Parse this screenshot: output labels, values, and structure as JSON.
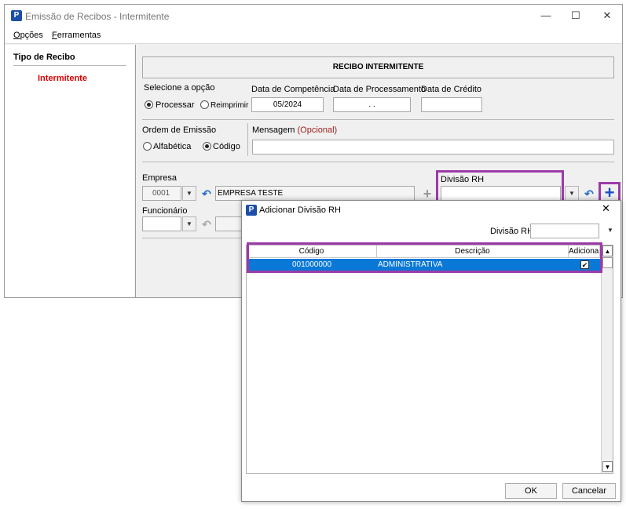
{
  "window": {
    "title": "Emissão de Recibos - Intermitente",
    "app_icon": "P",
    "controls": {
      "minimize": "—",
      "maximize": "☐",
      "close": "✕"
    }
  },
  "menu": {
    "opcoes_prefix": "O",
    "opcoes_rest": "pções",
    "ferramentas_prefix": "F",
    "ferramentas_rest": "erramentas"
  },
  "sidebar": {
    "heading": "Tipo de Recibo",
    "selected": "Intermitente",
    "selected_color": "#e00000"
  },
  "form": {
    "header": "RECIBO INTERMITENTE",
    "selecione_label": "Selecione a opção",
    "opt_processar": "Processar",
    "opt_reimprimir": "Reimprimir",
    "selected_option": "Processar",
    "competencia_label": "Data de Competência",
    "competencia_value": "05/2024",
    "processamento_label": "Data de Processamento",
    "processamento_value": "  .  .",
    "credito_label": "Data de Crédito",
    "credito_value": "",
    "ordem_label": "Ordem de Emissão",
    "ordem_alfabetica": "Alfabética",
    "ordem_codigo": "Código",
    "ordem_selected": "Código",
    "mensagem_label": "Mensagem",
    "mensagem_opcional": "(Opcional)",
    "mensagem_value": "",
    "empresa_label": "Empresa",
    "empresa_code": "0001",
    "empresa_name": "EMPRESA TESTE",
    "divisao_label": "Divisão RH",
    "divisao_value": "",
    "funcionario_label": "Funcionário",
    "funcionario_value": ""
  },
  "dialog": {
    "title": "Adicionar Divisão RH",
    "close": "✕",
    "filter_label": "Divisão RH:",
    "filter_value": "",
    "columns": [
      "Código",
      "Descrição",
      "Adicionar"
    ],
    "rows": [
      {
        "codigo": "001000000",
        "descricao": "ADMINISTRATIVA",
        "adicionar": true
      }
    ],
    "ok": "OK",
    "cancelar": "Cancelar",
    "selected_row_color": "#0a78d7",
    "highlight_color": "#9c3ba8"
  }
}
